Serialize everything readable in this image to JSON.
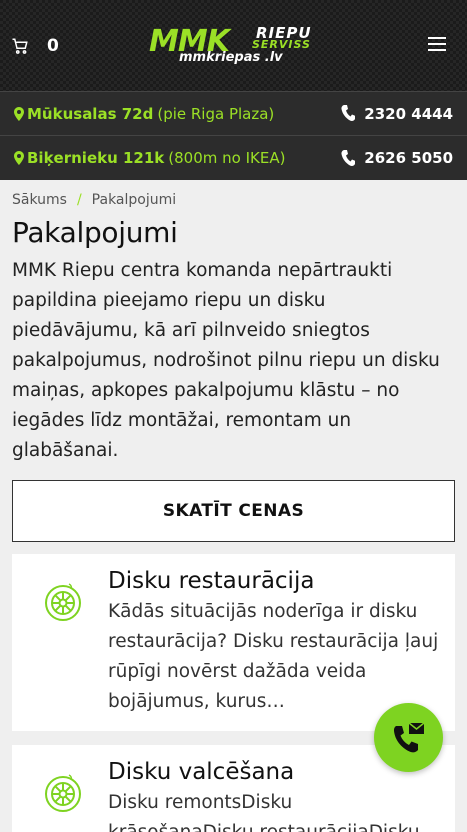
{
  "header": {
    "cart_count": "0",
    "logo": {
      "mmk": "MMK",
      "riepu": "RIEPU",
      "serviss": "SERVISS",
      "site": "mmkriepas .lv"
    }
  },
  "locations": [
    {
      "street": "Mūkusalas 72d",
      "note": "(pie Riga Plaza)",
      "phone": "2320 4444"
    },
    {
      "street": "Biķernieku 121k",
      "note": "(800m no IKEA)",
      "phone": "2626 5050"
    }
  ],
  "breadcrumb": {
    "home": "Sākums",
    "separator": "/",
    "current": "Pakalpojumi"
  },
  "page": {
    "title": "Pakalpojumi",
    "intro": "MMK Riepu centra komanda nepārtraukti papildina pieejamo riepu un disku piedāvājumu, kā arī pilnveido sniegtos pakalpojumus, nodrošinot pilnu riepu un disku maiņas, apkopes pakalpojumu klāstu – no iegādes līdz montāžai, remontam un glabāšanai.",
    "cta_label": "SKATĪT CENAS"
  },
  "services": [
    {
      "title": "Disku restaurācija",
      "excerpt": "Kādās situācijās noderīga ir disku restaurācija? Disku restaurācija ļauj rūpīgi novērst dažāda veida bojājumus, kurus…",
      "icon": "wheel-icon"
    },
    {
      "title": "Disku valcēšana",
      "excerpt": "Disku remontsDisku krāsošanaDisku restaurācijaDisku",
      "icon": "wheel-icon"
    }
  ],
  "colors": {
    "accent": "#9be026",
    "fab": "#7ed321",
    "dark": "#2c2c2c"
  }
}
